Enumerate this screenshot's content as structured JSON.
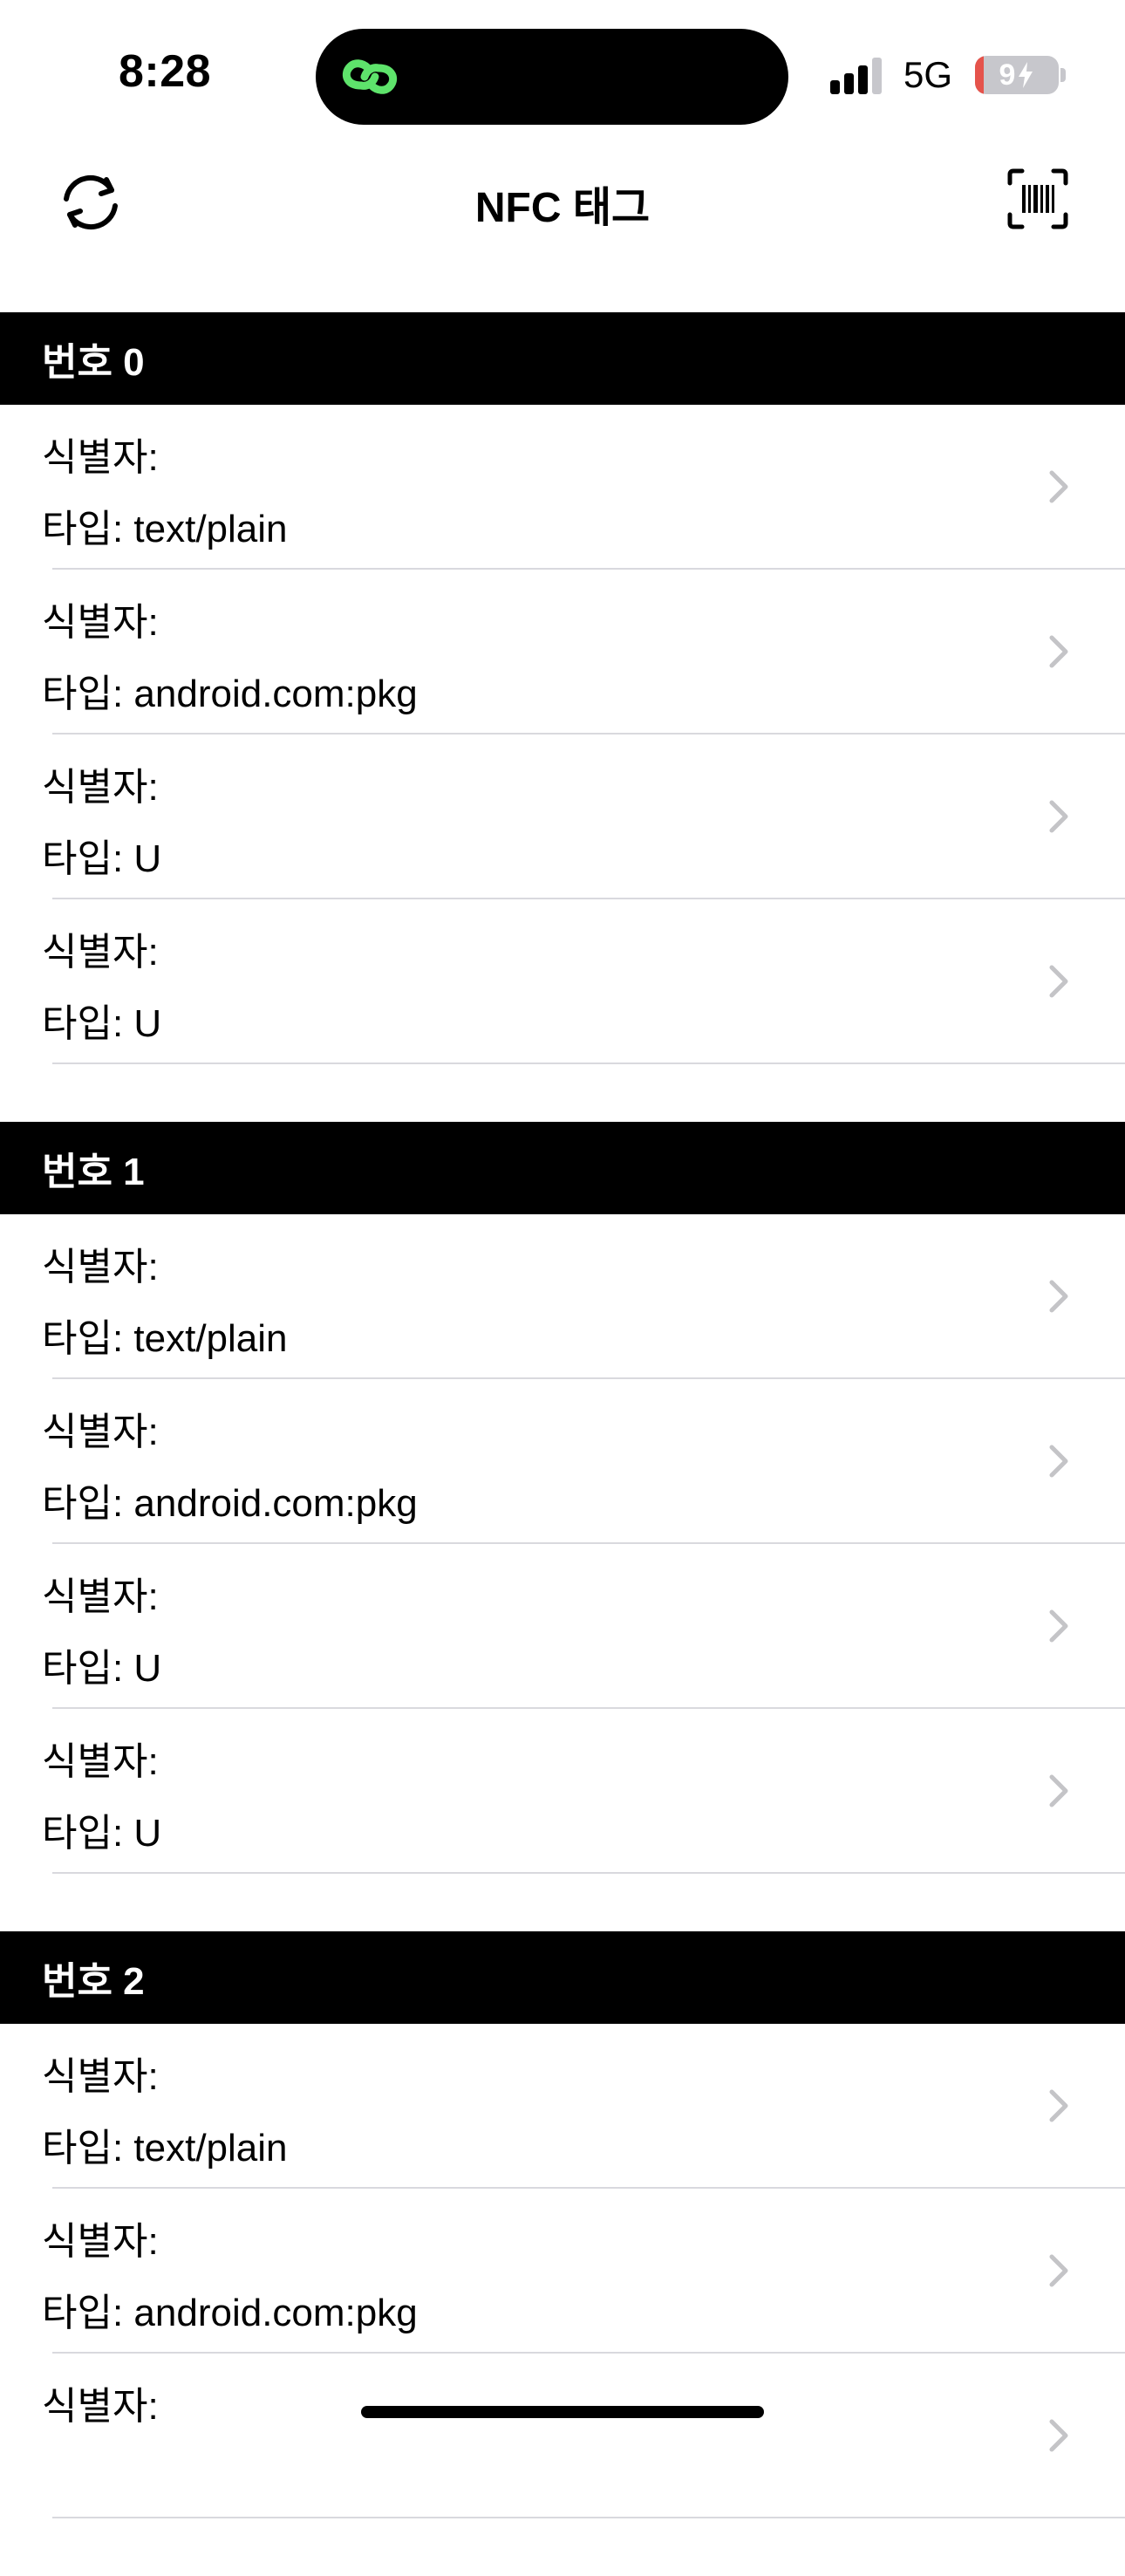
{
  "status_bar": {
    "time": "8:28",
    "network": "5G",
    "battery_level": "9",
    "battery_percent": 9,
    "battery_color": "#e5534b"
  },
  "nav": {
    "title": "NFC 태그",
    "left_icon": "refresh-icon",
    "right_icon": "barcode-scan-icon"
  },
  "sections": [
    {
      "title": "번호 0",
      "rows": [
        {
          "line1": "식별자:",
          "line2": "타입: text/plain"
        },
        {
          "line1": "식별자:",
          "line2": "타입: android.com:pkg"
        },
        {
          "line1": "식별자:",
          "line2": "타입: U"
        },
        {
          "line1": "식별자:",
          "line2": "타입: U"
        }
      ]
    },
    {
      "title": "번호 1",
      "rows": [
        {
          "line1": "식별자:",
          "line2": "타입: text/plain"
        },
        {
          "line1": "식별자:",
          "line2": "타입: android.com:pkg"
        },
        {
          "line1": "식별자:",
          "line2": "타입: U"
        },
        {
          "line1": "식별자:",
          "line2": "타입: U"
        }
      ]
    },
    {
      "title": "번호 2",
      "rows": [
        {
          "line1": "식별자:",
          "line2": "타입: text/plain"
        },
        {
          "line1": "식별자:",
          "line2": "타입: android.com:pkg"
        },
        {
          "line1": "식별자:",
          "line2": ""
        }
      ]
    }
  ],
  "colors": {
    "accent_green": "#5ee36b",
    "chevron": "#c4c4c7",
    "separator": "#d9d9de"
  }
}
